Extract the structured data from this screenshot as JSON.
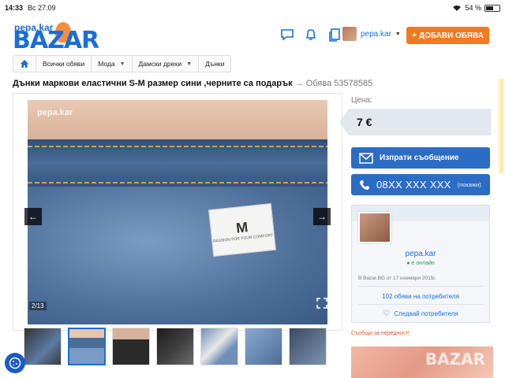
{
  "statusbar": {
    "time": "14:33",
    "date": "Вс 27.09",
    "battery": "54 %",
    "battery_level": 0.54
  },
  "header": {
    "logo_small": "pepa.kar",
    "logo_big": "BAZAR",
    "username": "pepa.kar",
    "add_button": "+ ДОБАВИ ОБЯВА",
    "icons": [
      "chat-icon",
      "bell-icon",
      "documents-icon"
    ]
  },
  "breadcrumbs": [
    "Всички обяви",
    "Мода",
    "Дамски дрехи",
    "Дънки"
  ],
  "listing": {
    "title": "Дънки маркови еластични S-M размер сини ,черните са подарък",
    "ad_number": "→ Обява 53578585"
  },
  "gallery": {
    "watermark": "pepa.kar",
    "counter": "2/13",
    "label_size": "M",
    "label_text": "PASSION FOR YOUR COMFORT"
  },
  "price": {
    "label": "Цена:",
    "value": "7 €"
  },
  "contact": {
    "message_button": "Изпрати съобщение",
    "phone": "08XX XXX XXX",
    "phone_hint": "(покажи)"
  },
  "seller": {
    "name": "pepa.kar",
    "status": "● е онлайн",
    "since": "В Bazar.BG от 17 ноември 2015г.",
    "ads_link": "102 обяви на потребителя",
    "follow_link": "Следвай потребителя"
  },
  "report_link": "Съобщи за нередност!",
  "promo_watermark": "BAZAR"
}
